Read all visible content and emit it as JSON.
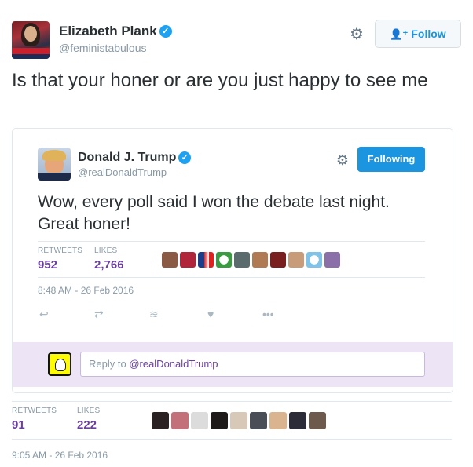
{
  "tweet": {
    "author_name": "Elizabeth Plank",
    "author_handle": "@feministabulous",
    "follow_label": "Follow",
    "text": "Is that your honer or are you just happy to see me",
    "stats": {
      "retweets_label": "RETWEETS",
      "retweets": "91",
      "likes_label": "LIKES",
      "likes": "222"
    },
    "timestamp": "9:05 AM - 26 Feb 2016"
  },
  "quoted": {
    "author_name": "Donald J. Trump",
    "author_handle": "@realDonaldTrump",
    "follow_label": "Following",
    "text": "Wow, every poll said I won the debate last night. Great honer!",
    "stats": {
      "retweets_label": "RETWEETS",
      "retweets": "952",
      "likes_label": "LIKES",
      "likes": "2,766"
    },
    "timestamp": "8:48 AM - 26 Feb 2016",
    "reply": {
      "prefix": "Reply to ",
      "mention": "@realDonaldTrump"
    }
  },
  "icons": {
    "verified": "verified-badge-icon",
    "gear": "gear-icon",
    "follow": "add-user-icon",
    "reply": "reply-icon",
    "retweet": "retweet-icon",
    "buffer": "buffer-icon",
    "like": "heart-icon",
    "more": "more-icon"
  },
  "colors": {
    "accent": "#1b95e0",
    "stat_value": "#6b3fa0",
    "reply_bar": "#ede5f5",
    "muted": "#8899a6"
  }
}
